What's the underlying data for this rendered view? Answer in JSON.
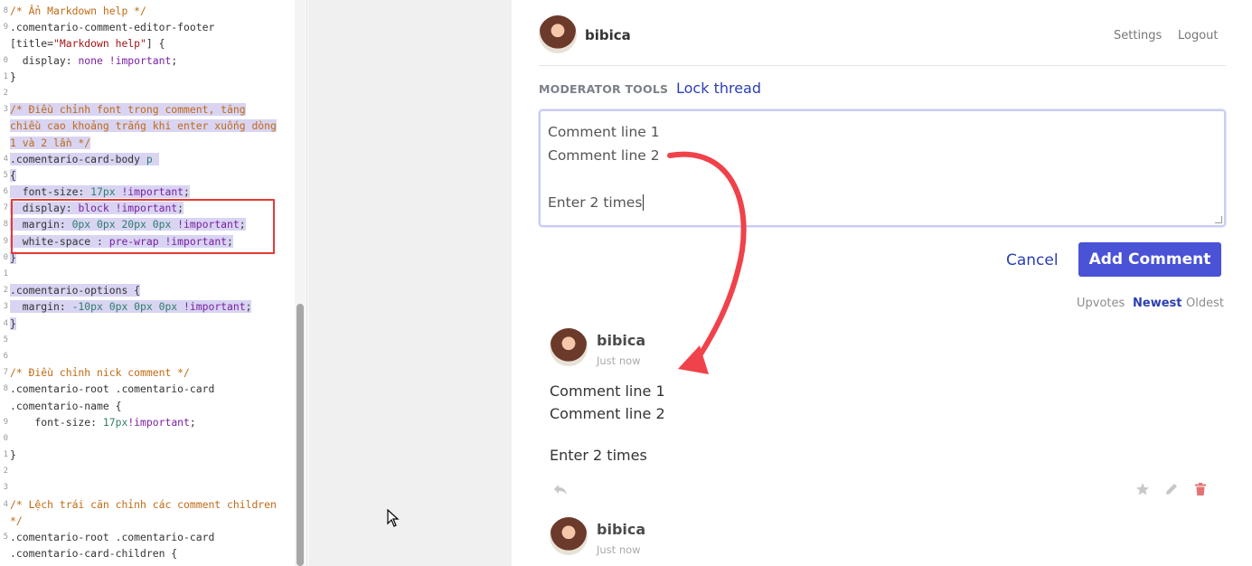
{
  "code": {
    "lines": [
      {
        "gn": "8",
        "segs": [
          {
            "t": "/* Ẩn Markdown help */",
            "c": "cm"
          }
        ]
      },
      {
        "gn": "9",
        "segs": [
          {
            "t": ".comentario-comment-editor-footer",
            "c": "sel"
          }
        ]
      },
      {
        "gn": "",
        "segs": [
          {
            "t": "[title=",
            "c": "sel"
          },
          {
            "t": "\"Markdown help\"",
            "c": "str"
          },
          {
            "t": "] {",
            "c": "sel"
          }
        ]
      },
      {
        "gn": "0",
        "segs": [
          {
            "t": "  display: ",
            "c": "prop"
          },
          {
            "t": "none !important",
            "c": "val"
          },
          {
            "t": ";",
            "c": "prop"
          }
        ]
      },
      {
        "gn": "1",
        "segs": [
          {
            "t": "}",
            "c": "sel"
          }
        ]
      },
      {
        "gn": "2",
        "segs": [
          {
            "t": "",
            "c": "sel"
          }
        ]
      },
      {
        "gn": "3",
        "hl": true,
        "segs": [
          {
            "t": "/* Điều chỉnh font trong comment, tăng",
            "c": "cm"
          }
        ]
      },
      {
        "gn": "",
        "hl": true,
        "segs": [
          {
            "t": "chiều cao khoảng trắng khi enter xuống dòng",
            "c": "cm"
          }
        ]
      },
      {
        "gn": "",
        "hl": true,
        "segs": [
          {
            "t": "1 và 2 lần */",
            "c": "cm"
          }
        ]
      },
      {
        "gn": "4",
        "hl": true,
        "segs": [
          {
            "t": ".comentario-card-body ",
            "c": "sel"
          },
          {
            "t": "p ",
            "c": "num"
          }
        ]
      },
      {
        "gn": "5",
        "hl": true,
        "segs": [
          {
            "t": "{",
            "c": "sel"
          }
        ]
      },
      {
        "gn": "6",
        "hl": true,
        "segs": [
          {
            "t": "  font-size: ",
            "c": "prop"
          },
          {
            "t": "17px",
            "c": "num"
          },
          {
            "t": " !important",
            "c": "val"
          },
          {
            "t": ";",
            "c": "prop"
          }
        ]
      },
      {
        "gn": "7",
        "hl": true,
        "segs": [
          {
            "t": "  display: ",
            "c": "prop"
          },
          {
            "t": "block !important",
            "c": "val"
          },
          {
            "t": ";",
            "c": "prop"
          }
        ]
      },
      {
        "gn": "8",
        "hl": true,
        "segs": [
          {
            "t": "  margin: ",
            "c": "prop"
          },
          {
            "t": "0px 0px 20px 0px",
            "c": "num"
          },
          {
            "t": " !important",
            "c": "val"
          },
          {
            "t": ";",
            "c": "prop"
          }
        ]
      },
      {
        "gn": "9",
        "hl": true,
        "segs": [
          {
            "t": "  white-space : ",
            "c": "prop"
          },
          {
            "t": "pre-wrap !important",
            "c": "val"
          },
          {
            "t": ";",
            "c": "prop"
          }
        ]
      },
      {
        "gn": "0",
        "hl": true,
        "segs": [
          {
            "t": "}",
            "c": "sel"
          }
        ]
      },
      {
        "gn": "1",
        "segs": [
          {
            "t": "",
            "c": "sel"
          }
        ]
      },
      {
        "gn": "2",
        "hl": true,
        "segs": [
          {
            "t": ".comentario-options {",
            "c": "sel"
          }
        ]
      },
      {
        "gn": "3",
        "hl": true,
        "segs": [
          {
            "t": "  margin: ",
            "c": "prop"
          },
          {
            "t": "-10px 0px 0px 0px",
            "c": "num"
          },
          {
            "t": " !important",
            "c": "val"
          },
          {
            "t": ";",
            "c": "prop"
          }
        ]
      },
      {
        "gn": "4",
        "hl": true,
        "segs": [
          {
            "t": "}",
            "c": "sel"
          }
        ]
      },
      {
        "gn": "5",
        "segs": [
          {
            "t": "",
            "c": "sel"
          }
        ]
      },
      {
        "gn": "6",
        "segs": [
          {
            "t": "",
            "c": "sel"
          }
        ]
      },
      {
        "gn": "7",
        "segs": [
          {
            "t": "/* Điều chỉnh nick comment */",
            "c": "cm"
          }
        ]
      },
      {
        "gn": "8",
        "segs": [
          {
            "t": ".comentario-root .comentario-card",
            "c": "sel"
          }
        ]
      },
      {
        "gn": "",
        "segs": [
          {
            "t": ".comentario-name {",
            "c": "sel"
          }
        ]
      },
      {
        "gn": "9",
        "segs": [
          {
            "t": "    font-size: ",
            "c": "prop"
          },
          {
            "t": "17px",
            "c": "num"
          },
          {
            "t": "!important",
            "c": "val"
          },
          {
            "t": ";",
            "c": "prop"
          }
        ]
      },
      {
        "gn": "0",
        "segs": [
          {
            "t": "",
            "c": "sel"
          }
        ]
      },
      {
        "gn": "1",
        "segs": [
          {
            "t": "}",
            "c": "sel"
          }
        ]
      },
      {
        "gn": "2",
        "segs": [
          {
            "t": "",
            "c": "sel"
          }
        ]
      },
      {
        "gn": "3",
        "segs": [
          {
            "t": "",
            "c": "sel"
          }
        ]
      },
      {
        "gn": "4",
        "segs": [
          {
            "t": "/* Lệch trái căn chỉnh các comment children",
            "c": "cm"
          }
        ]
      },
      {
        "gn": "",
        "segs": [
          {
            "t": "*/",
            "c": "cm"
          }
        ]
      },
      {
        "gn": "5",
        "segs": [
          {
            "t": ".comentario-root .comentario-card",
            "c": "sel"
          }
        ]
      },
      {
        "gn": "",
        "segs": [
          {
            "t": ".comentario-card-children {",
            "c": "sel"
          }
        ]
      }
    ]
  },
  "header": {
    "username": "bibica",
    "settings_label": "Settings",
    "logout_label": "Logout"
  },
  "moderator": {
    "title": "MODERATOR TOOLS",
    "lock_label": "Lock thread"
  },
  "editor": {
    "lines": [
      "Comment line 1",
      "Comment line 2",
      "",
      "Enter 2 times"
    ]
  },
  "actions": {
    "cancel_label": "Cancel",
    "add_label": "Add Comment"
  },
  "sort": {
    "upvotes": "Upvotes",
    "newest": "Newest",
    "oldest": "Oldest"
  },
  "comments": [
    {
      "name": "bibica",
      "time": "Just now",
      "lines": [
        "Comment line 1",
        "Comment line 2",
        "Enter 2 times"
      ]
    },
    {
      "name": "bibica",
      "time": "Just now"
    }
  ],
  "colors": {
    "accent": "#4a52d6",
    "link": "#2b3fb0",
    "arrow": "#f0424a",
    "delete": "#e57373"
  },
  "icons": {
    "reply": "reply-icon",
    "star": "star-icon",
    "edit": "pencil-icon",
    "delete": "trash-icon"
  }
}
